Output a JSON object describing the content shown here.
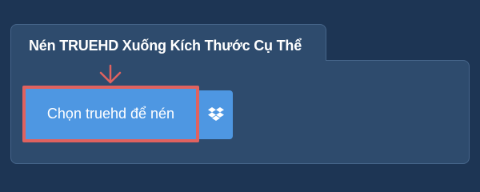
{
  "panel": {
    "title": "Nén TRUEHD Xuống Kích Thước Cụ Thể"
  },
  "upload": {
    "choose_label": "Chọn truehd để nén",
    "dropbox_icon": "dropbox-icon"
  },
  "colors": {
    "background": "#1d3554",
    "panel": "#2e4b6d",
    "button": "#4e97e2",
    "highlight": "#e0625f"
  }
}
